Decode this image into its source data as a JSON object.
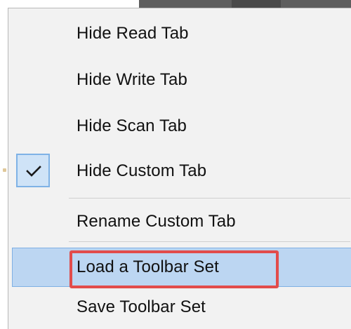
{
  "menu": {
    "items": [
      {
        "label": "Hide Read Tab",
        "checked": false
      },
      {
        "label": "Hide Write Tab",
        "checked": false
      },
      {
        "label": "Hide Scan Tab",
        "checked": false
      },
      {
        "label": "Hide Custom Tab",
        "checked": true
      },
      {
        "label": "Rename Custom Tab",
        "checked": false
      },
      {
        "label": "Load a Toolbar Set",
        "checked": false,
        "highlighted": true
      },
      {
        "label": "Save Toolbar Set",
        "checked": false
      }
    ]
  },
  "colors": {
    "menu_background": "#f2f2f2",
    "highlight_background": "#bcd6f2",
    "highlight_border": "#7fb0e4",
    "check_background": "#cfe3f7",
    "callout_red": "#e24c4b"
  },
  "icons": {
    "checkmark": "checkmark-icon"
  }
}
